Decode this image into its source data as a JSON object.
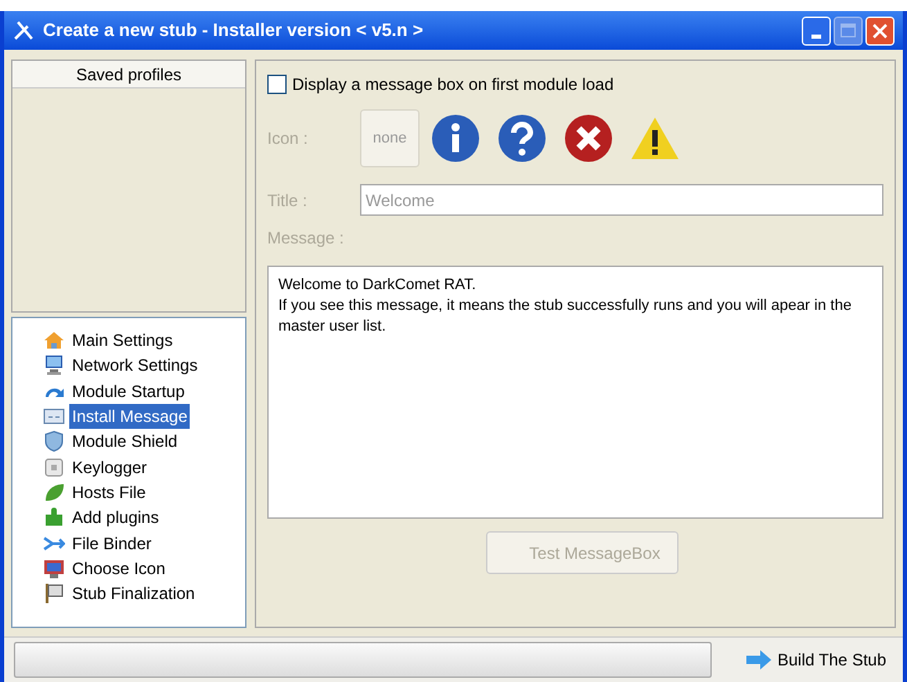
{
  "window": {
    "title": "Create a new stub - Installer version < v5.n >"
  },
  "saved_profiles": {
    "header": "Saved profiles"
  },
  "tree": {
    "items": [
      {
        "label": "Main Settings",
        "selected": false
      },
      {
        "label": "Network Settings",
        "selected": false
      },
      {
        "label": "Module Startup",
        "selected": false
      },
      {
        "label": "Install Message",
        "selected": true
      },
      {
        "label": "Module Shield",
        "selected": false
      },
      {
        "label": "Keylogger",
        "selected": false
      },
      {
        "label": "Hosts File",
        "selected": false
      },
      {
        "label": "Add plugins",
        "selected": false
      },
      {
        "label": "File Binder",
        "selected": false
      },
      {
        "label": "Choose Icon",
        "selected": false
      },
      {
        "label": "Stub Finalization",
        "selected": false
      }
    ]
  },
  "form": {
    "display_checkbox": {
      "label": "Display a message box on first module load",
      "checked": false
    },
    "icon_label": "Icon :",
    "none_button": "none",
    "title_label": "Title :",
    "title_value": "Welcome",
    "message_label": "Message :",
    "message_lines": [
      "Welcome to DarkComet RAT.",
      "If you see this message, it means the stub successfully runs and you will apear in the master user list."
    ],
    "test_button": {
      "label": "Test MessageBox",
      "disabled": true
    }
  },
  "status_bar": {
    "progress": {
      "level": 0
    },
    "build_button": "Build The Stub"
  }
}
